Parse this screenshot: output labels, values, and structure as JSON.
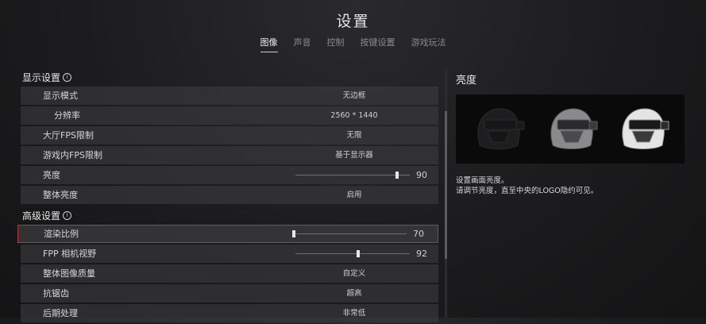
{
  "header": {
    "title": "设置"
  },
  "tabs": [
    {
      "label": "图像",
      "active": true
    },
    {
      "label": "声音"
    },
    {
      "label": "控制"
    },
    {
      "label": "按键设置"
    },
    {
      "label": "游戏玩法"
    }
  ],
  "display_settings": {
    "heading": "显示设置",
    "rows": [
      {
        "label": "显示模式",
        "value": "无边框"
      },
      {
        "label": "分辨率",
        "value": "2560 * 1440"
      },
      {
        "label": "大厅FPS限制",
        "value": "无限"
      },
      {
        "label": "游戏内FPS限制",
        "value": "基于显示器"
      },
      {
        "label": "亮度",
        "value": "90",
        "level": 0.9
      },
      {
        "label": "整体亮度",
        "value": "启用"
      }
    ]
  },
  "advanced_settings": {
    "heading": "高级设置",
    "rows": [
      {
        "label": "渲染比例",
        "value": "70",
        "level": 0.0
      },
      {
        "label": "FPP 相机视野",
        "value": "92",
        "level": 0.55
      },
      {
        "label": "整体图像质量",
        "value": "自定义"
      },
      {
        "label": "抗锯齿",
        "value": "超高"
      },
      {
        "label": "后期处理",
        "value": "非常低"
      }
    ]
  },
  "preview_panel": {
    "title": "亮度",
    "description_line1": "设置画面亮度。",
    "description_line2": "请调节亮度，直至中央的LOGO隐约可见。",
    "icon": "helmet-logo-icon"
  },
  "colors": {
    "highlight_border": "#b23a3a",
    "row_background": "#3c3c3f"
  }
}
